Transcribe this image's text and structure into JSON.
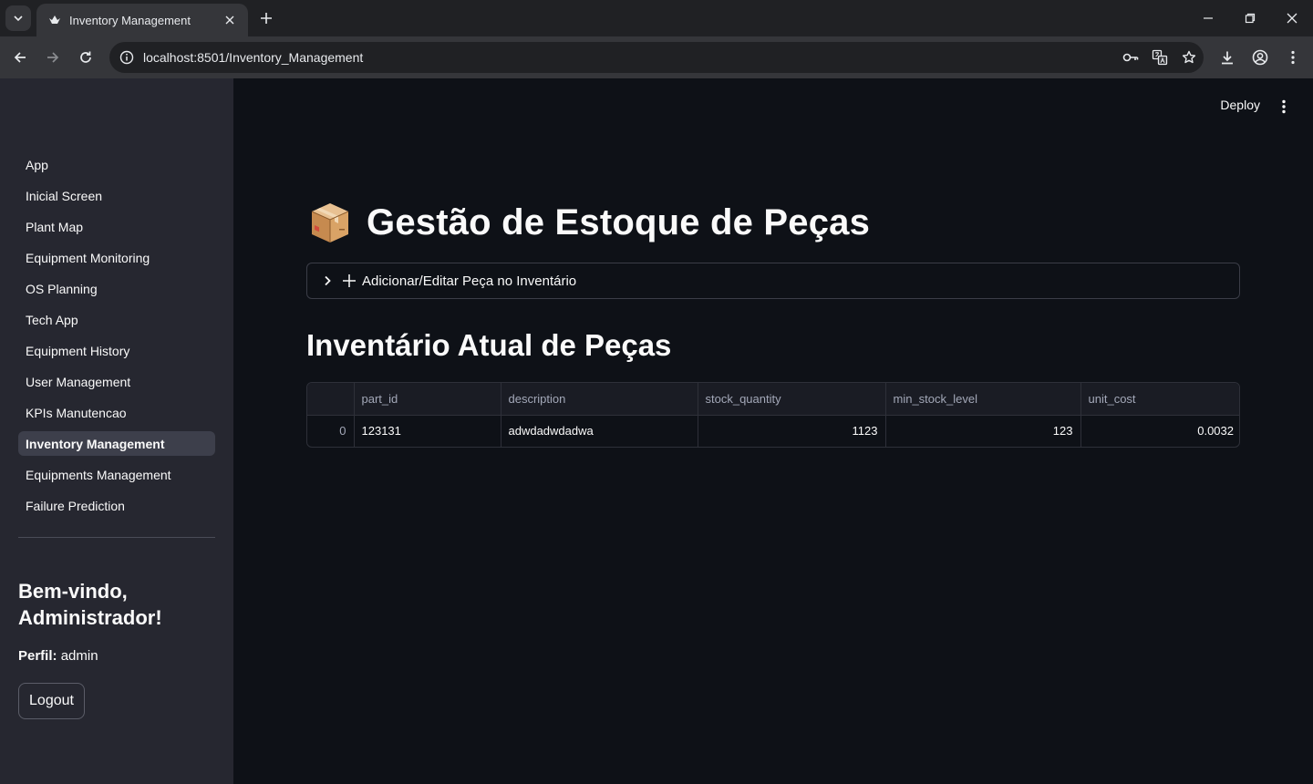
{
  "browser": {
    "tab_title": "Inventory Management",
    "url": "localhost:8501/Inventory_Management"
  },
  "header": {
    "deploy_label": "Deploy"
  },
  "sidebar": {
    "items": [
      {
        "label": "App",
        "active": false
      },
      {
        "label": "Inicial Screen",
        "active": false
      },
      {
        "label": "Plant Map",
        "active": false
      },
      {
        "label": "Equipment Monitoring",
        "active": false
      },
      {
        "label": "OS Planning",
        "active": false
      },
      {
        "label": "Tech App",
        "active": false
      },
      {
        "label": "Equipment History",
        "active": false
      },
      {
        "label": "User Management",
        "active": false
      },
      {
        "label": "KPIs Manutencao",
        "active": false
      },
      {
        "label": "Inventory Management",
        "active": true
      },
      {
        "label": "Equipments Management",
        "active": false
      },
      {
        "label": "Failure Prediction",
        "active": false
      }
    ],
    "welcome": "Bem-vindo, Administrador!",
    "profile_label": "Perfil:",
    "profile_value": "admin",
    "logout_label": "Logout"
  },
  "main": {
    "title": "Gestão de Estoque de Peças",
    "expander_label": "Adicionar/Editar Peça no Inventário",
    "section_title": "Inventário Atual de Peças",
    "table": {
      "columns": [
        "",
        "part_id",
        "description",
        "stock_quantity",
        "min_stock_level",
        "unit_cost"
      ],
      "rows": [
        [
          "0",
          "123131",
          "adwdadwdadwa",
          "1123",
          "123",
          "0.0032"
        ]
      ]
    }
  },
  "colors": {
    "main_bg": "#0e1117",
    "sidebar_bg": "#262730",
    "active_item_bg": "#3d3f4b",
    "text": "#fafafa"
  }
}
